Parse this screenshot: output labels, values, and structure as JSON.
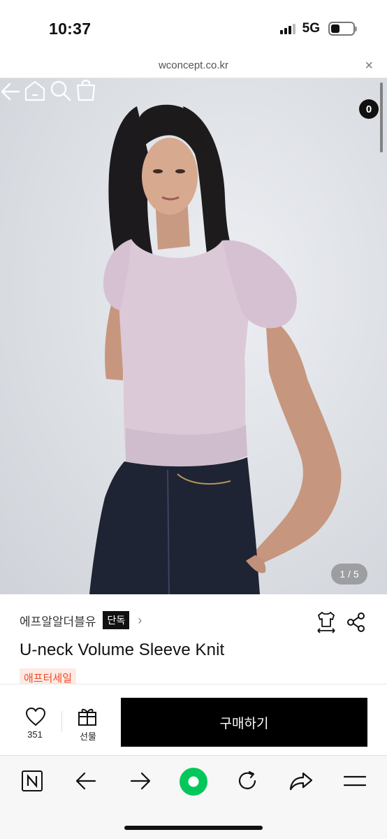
{
  "status": {
    "time": "10:37",
    "network": "5G"
  },
  "browser": {
    "url": "wconcept.co.kr",
    "close": "×"
  },
  "hero": {
    "cart_count": "0",
    "pager": "1 / 5"
  },
  "product": {
    "brand": "에프알알더블유",
    "exclusive_badge": "단독",
    "chevron": "›",
    "title": "U-neck Volume Sleeve Knit",
    "sale_tag": "애프터세일"
  },
  "actions": {
    "like_count": "351",
    "gift_label": "선물",
    "buy_label": "구매하기"
  },
  "colors": {
    "accent_sale": "#f04a23",
    "buy_button": "#000000",
    "naver_green": "#03c75a"
  },
  "icons": [
    "back-arrow-icon",
    "home-icon",
    "search-icon",
    "cart-icon",
    "size-guide-icon",
    "share-icon",
    "heart-icon",
    "gift-icon",
    "naver-icon",
    "browser-back-icon",
    "browser-forward-icon",
    "green-dot-icon",
    "reload-icon",
    "browser-share-icon",
    "menu-icon"
  ]
}
